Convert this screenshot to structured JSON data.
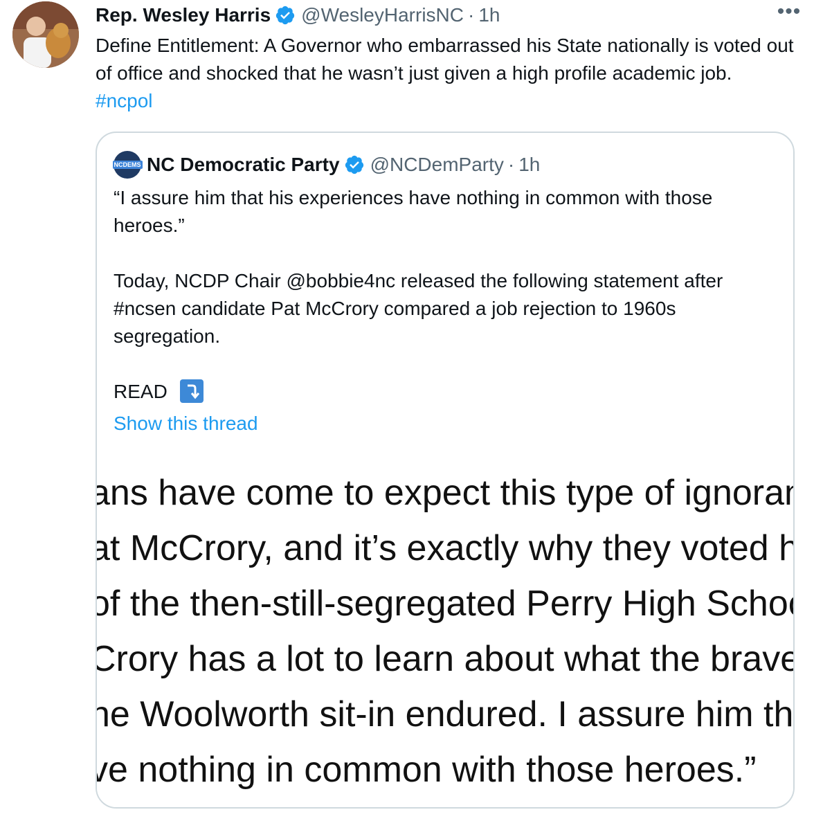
{
  "tweet": {
    "author_name": "Rep. Wesley Harris",
    "handle": "@WesleyHarrisNC",
    "separator": "·",
    "time": "1h",
    "more": "•••",
    "text": "Define Entitlement:  A Governor who embarrassed his State nationally is voted out of office and shocked that he wasn’t just given a high profile academic job.",
    "hashtag": "#ncpol"
  },
  "quote": {
    "avatar_label": "NCDEMS",
    "author_name": "NC Democratic Party",
    "handle": "@NCDemParty",
    "separator": "·",
    "time": "1h",
    "para1": "“I assure him that his experiences have nothing in common with those heroes.”",
    "para2": "Today, NCDP Chair @bobbie4nc released the following statement after #ncsen candidate Pat McCrory compared a job rejection to 1960s segregation.",
    "read_label": "READ",
    "read_icon": "⤵",
    "show_thread": "Show this thread",
    "image_lines": [
      "ans have come to expect this type of ignoran",
      "at McCrory, and it’s exactly why they voted h",
      "of the then-still-segregated Perry High Schoo",
      "Crory has a lot to learn about what the brave",
      "he Woolworth sit-in endured. I assure him th",
      "ve nothing in common with those heroes.”"
    ]
  },
  "colors": {
    "link": "#1d9bf0",
    "muted": "#536471",
    "verified": "#1d9bf0"
  }
}
